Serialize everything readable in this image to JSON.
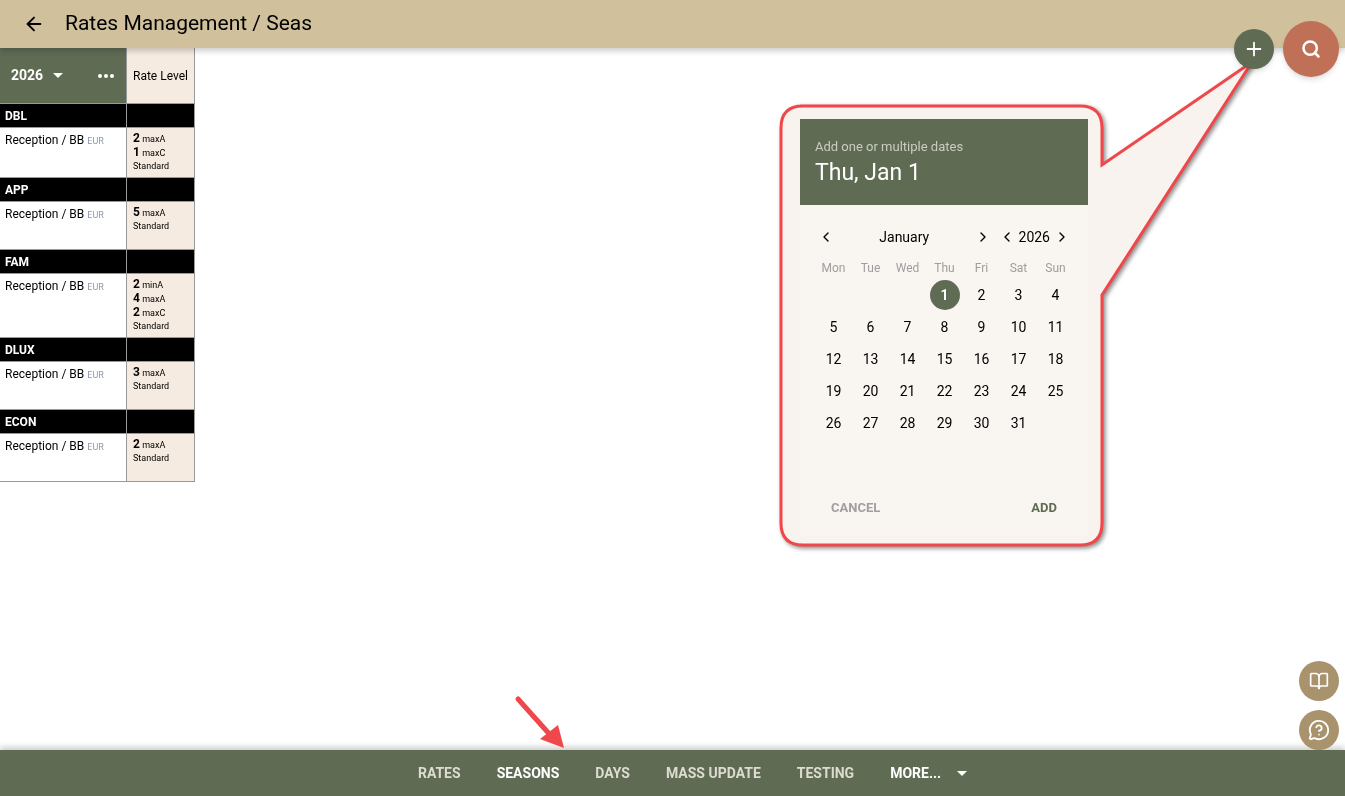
{
  "header": {
    "title": "Rates Management / Seas"
  },
  "table": {
    "year": "2026",
    "column_2": "Rate Level",
    "groups": [
      {
        "name": "DBL",
        "rows": [
          {
            "label": "Reception / BB",
            "currency": "EUR",
            "rate_lines": [
              {
                "count": "2",
                "type": "maxA"
              },
              {
                "count": "1",
                "type": "maxC"
              }
            ],
            "rate_level": "Standard"
          }
        ]
      },
      {
        "name": "APP",
        "rows": [
          {
            "label": "Reception / BB",
            "currency": "EUR",
            "rate_lines": [
              {
                "count": "5",
                "type": "maxA"
              }
            ],
            "rate_level": "Standard"
          }
        ]
      },
      {
        "name": "FAM",
        "rows": [
          {
            "label": "Reception / BB",
            "currency": "EUR",
            "rate_lines": [
              {
                "count": "2",
                "type": "minA"
              },
              {
                "count": "4",
                "type": "maxA"
              },
              {
                "count": "2",
                "type": "maxC"
              }
            ],
            "rate_level": "Standard"
          }
        ]
      },
      {
        "name": "DLUX",
        "rows": [
          {
            "label": "Reception / BB",
            "currency": "EUR",
            "rate_lines": [
              {
                "count": "3",
                "type": "maxA"
              }
            ],
            "rate_level": "Standard"
          }
        ]
      },
      {
        "name": "ECON",
        "rows": [
          {
            "label": "Reception / BB",
            "currency": "EUR",
            "rate_lines": [
              {
                "count": "2",
                "type": "maxA"
              }
            ],
            "rate_level": "Standard"
          }
        ]
      }
    ]
  },
  "date_picker": {
    "subtitle": "Add one or multiple dates",
    "selected_date_label": "Thu, Jan 1",
    "month": "January",
    "year": "2026",
    "weekdays": [
      "Mon",
      "Tue",
      "Wed",
      "Thu",
      "Fri",
      "Sat",
      "Sun"
    ],
    "weeks": [
      [
        {
          "kind": "blank"
        },
        {
          "kind": "blank"
        },
        {
          "kind": "blank"
        },
        {
          "kind": "day",
          "day": "1",
          "selected": true
        },
        {
          "day": "2",
          "selected": false
        },
        {
          "day": "3",
          "selected": false
        },
        {
          "day": "4",
          "selected": false
        }
      ],
      [
        {
          "day": "5",
          "selected": false
        },
        {
          "day": "6",
          "selected": false
        },
        {
          "day": "7",
          "selected": false
        },
        {
          "day": "8",
          "selected": false
        },
        {
          "day": "9",
          "selected": false
        },
        {
          "day": "10",
          "selected": false
        },
        {
          "day": "11",
          "selected": false
        }
      ],
      [
        {
          "day": "12",
          "selected": false
        },
        {
          "day": "13",
          "selected": false
        },
        {
          "day": "14",
          "selected": false
        },
        {
          "day": "15",
          "selected": false
        },
        {
          "day": "16",
          "selected": false
        },
        {
          "day": "17",
          "selected": false
        },
        {
          "day": "18",
          "selected": false
        }
      ],
      [
        {
          "day": "19",
          "selected": false
        },
        {
          "day": "20",
          "selected": false
        },
        {
          "day": "21",
          "selected": false
        },
        {
          "day": "22",
          "selected": false
        },
        {
          "day": "23",
          "selected": false
        },
        {
          "day": "24",
          "selected": false
        },
        {
          "day": "25",
          "selected": false
        }
      ],
      [
        {
          "day": "26",
          "selected": false
        },
        {
          "day": "27",
          "selected": false
        },
        {
          "day": "28",
          "selected": false
        },
        {
          "day": "29",
          "selected": false
        },
        {
          "day": "30",
          "selected": false
        },
        {
          "day": "31",
          "selected": false
        },
        {
          "kind": "blank"
        }
      ]
    ],
    "actions": [
      {
        "label": "CANCEL",
        "kind": "secondary"
      },
      {
        "label": "ADD",
        "kind": "primary"
      }
    ]
  },
  "bottom_nav": {
    "tabs": [
      {
        "label": "RATES",
        "selected": false
      },
      {
        "label": "SEASONS",
        "selected": true
      },
      {
        "label": "DAYS",
        "selected": false
      },
      {
        "label": "MASS UPDATE",
        "selected": false
      },
      {
        "label": "TESTING",
        "selected": false
      }
    ],
    "more": "MORE..."
  }
}
